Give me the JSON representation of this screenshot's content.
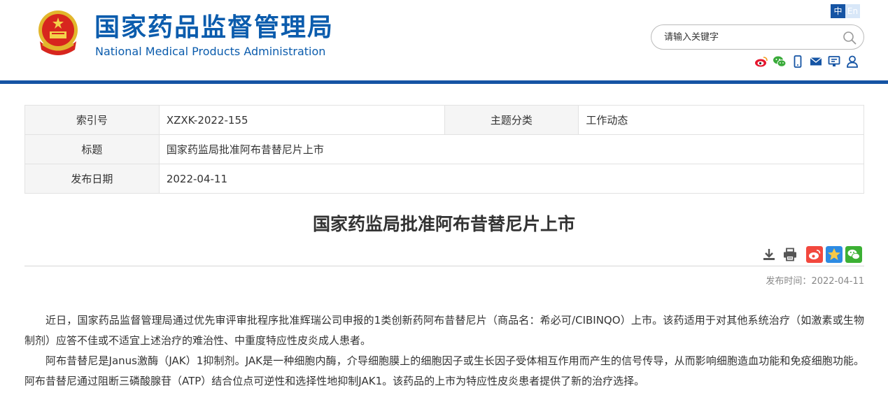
{
  "header": {
    "title_cn": "国家药品监督管理局",
    "title_en": "National Medical Products Administration",
    "lang_zh": "中",
    "lang_en": "En",
    "search_placeholder": "请输入关键字",
    "brand_color": "#1554a4",
    "social_icons": [
      "weibo-icon",
      "wechat-icon",
      "mobile-icon",
      "mail-icon",
      "monitor-icon",
      "user-icon"
    ]
  },
  "info_table": {
    "index_label": "索引号",
    "index_value": "XZXK-2022-155",
    "category_label": "主题分类",
    "category_value": "工作动态",
    "title_label": "标题",
    "title_value": "国家药监局批准阿布昔替尼片上市",
    "date_label": "发布日期",
    "date_value": "2022-04-11"
  },
  "article": {
    "title": "国家药监局批准阿布昔替尼片上市",
    "tools": [
      "download-icon",
      "print-icon",
      "weibo-share-icon",
      "qzone-share-icon",
      "wechat-share-icon"
    ],
    "pubdate_label": "发布时间：",
    "pubdate_value": "2022-04-11",
    "paragraphs": [
      "近日，国家药品监督管理局通过优先审评审批程序批准辉瑞公司申报的1类创新药阿布昔替尼片（商品名：希必可/CIBINQO）上市。该药适用于对其他系统治疗（如激素或生物制剂）应答不佳或不适宜上述治疗的难治性、中重度特应性皮炎成人患者。",
      "阿布昔替尼是Janus激酶（JAK）1抑制剂。JAK是一种细胞内酶，介导细胞膜上的细胞因子或生长因子受体相互作用而产生的信号传导，从而影响细胞造血功能和免疫细胞功能。阿布昔替尼通过阻断三磷酸腺苷（ATP）结合位点可逆性和选择性地抑制JAK1。该药品的上市为特应性皮炎患者提供了新的治疗选择。"
    ]
  }
}
